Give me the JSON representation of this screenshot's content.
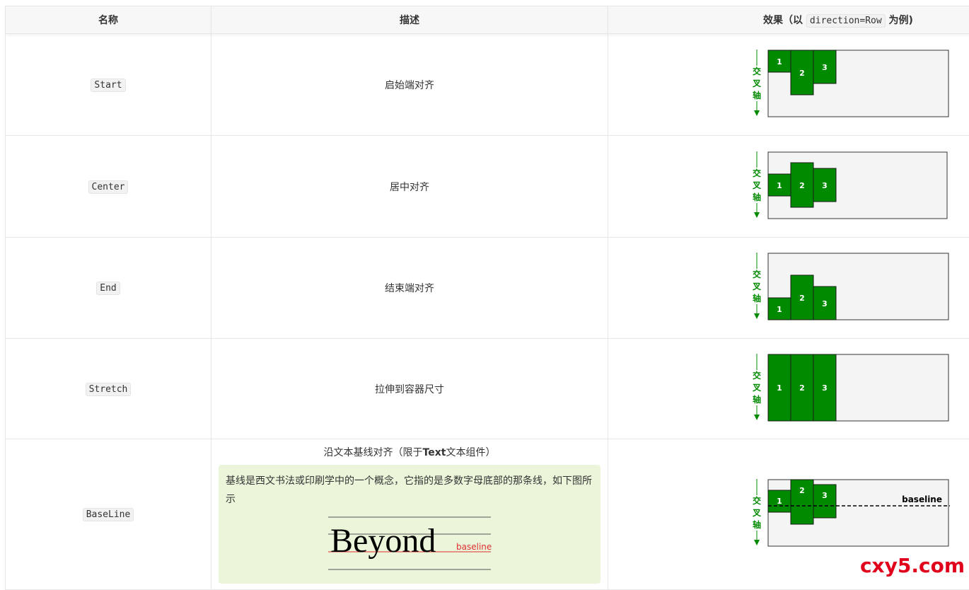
{
  "header": {
    "col_name": "名称",
    "col_desc": "描述",
    "col_effect_prefix": "效果（以",
    "col_effect_code": "direction=Row",
    "col_effect_suffix": "为例)"
  },
  "rows": [
    {
      "name": "Start",
      "desc": "启始端对齐"
    },
    {
      "name": "Center",
      "desc": "居中对齐"
    },
    {
      "name": "End",
      "desc": "结束端对齐"
    },
    {
      "name": "Stretch",
      "desc": "拉伸到容器尺寸"
    },
    {
      "name": "BaseLine",
      "desc_prefix": "沿文本基线对齐（限于",
      "desc_bold": "Text",
      "desc_suffix": "文本组件）",
      "note": "基线是西文书法或印刷学中的一个概念，它指的是多数字母底部的那条线，如下图所示",
      "figure_word": "Beyond",
      "figure_label": "baseline"
    }
  ],
  "diagram": {
    "axis_label_1": "交",
    "axis_label_2": "叉",
    "axis_label_3": "轴",
    "items": [
      "1",
      "2",
      "3"
    ],
    "baseline_label": "baseline",
    "accent": "#008a00",
    "box_bg": "#f4f4f4"
  },
  "watermark": "cxy5.com"
}
